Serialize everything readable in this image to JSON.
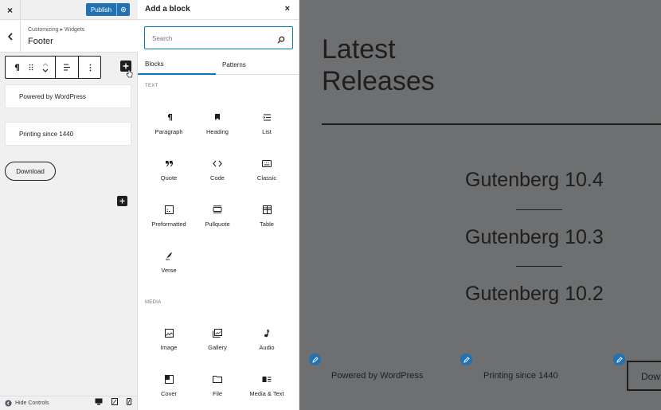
{
  "left_panel": {
    "close_label": "×",
    "publish_label": "Publish",
    "breadcrumb": "Customizing ▸ Widgets",
    "section_title": "Footer",
    "widgets": [
      {
        "text": "Powered by WordPress"
      },
      {
        "text": "Printing since 1440"
      }
    ],
    "download_button": "Download",
    "hide_controls": "Hide Controls"
  },
  "inserter": {
    "title": "Add a block",
    "close_label": "×",
    "search_placeholder": "Search",
    "tabs": [
      {
        "label": "Blocks",
        "active": true
      },
      {
        "label": "Patterns",
        "active": false
      }
    ],
    "categories": [
      {
        "name": "TEXT",
        "blocks": [
          {
            "label": "Paragraph",
            "icon": "paragraph-icon"
          },
          {
            "label": "Heading",
            "icon": "heading-icon"
          },
          {
            "label": "List",
            "icon": "list-icon"
          },
          {
            "label": "Quote",
            "icon": "quote-icon"
          },
          {
            "label": "Code",
            "icon": "code-icon"
          },
          {
            "label": "Classic",
            "icon": "classic-icon"
          },
          {
            "label": "Preformatted",
            "icon": "preformatted-icon"
          },
          {
            "label": "Pullquote",
            "icon": "pullquote-icon"
          },
          {
            "label": "Table",
            "icon": "table-icon"
          },
          {
            "label": "Verse",
            "icon": "verse-icon"
          }
        ]
      },
      {
        "name": "MEDIA",
        "blocks": [
          {
            "label": "Image",
            "icon": "image-icon"
          },
          {
            "label": "Gallery",
            "icon": "gallery-icon"
          },
          {
            "label": "Audio",
            "icon": "audio-icon"
          },
          {
            "label": "Cover",
            "icon": "cover-icon"
          },
          {
            "label": "File",
            "icon": "file-icon"
          },
          {
            "label": "Media & Text",
            "icon": "media-text-icon"
          }
        ]
      }
    ]
  },
  "preview": {
    "title": "Latest Releases",
    "releases": [
      "Gutenberg 10.4",
      "Gutenberg 10.3",
      "Gutenberg 10.2"
    ],
    "footer_texts": [
      "Powered by WordPress",
      "Printing since 1440"
    ],
    "download_partial": "Dow"
  },
  "colors": {
    "accent": "#2271b1",
    "focus": "#007cba",
    "preview_bg": "#6d6f71"
  }
}
